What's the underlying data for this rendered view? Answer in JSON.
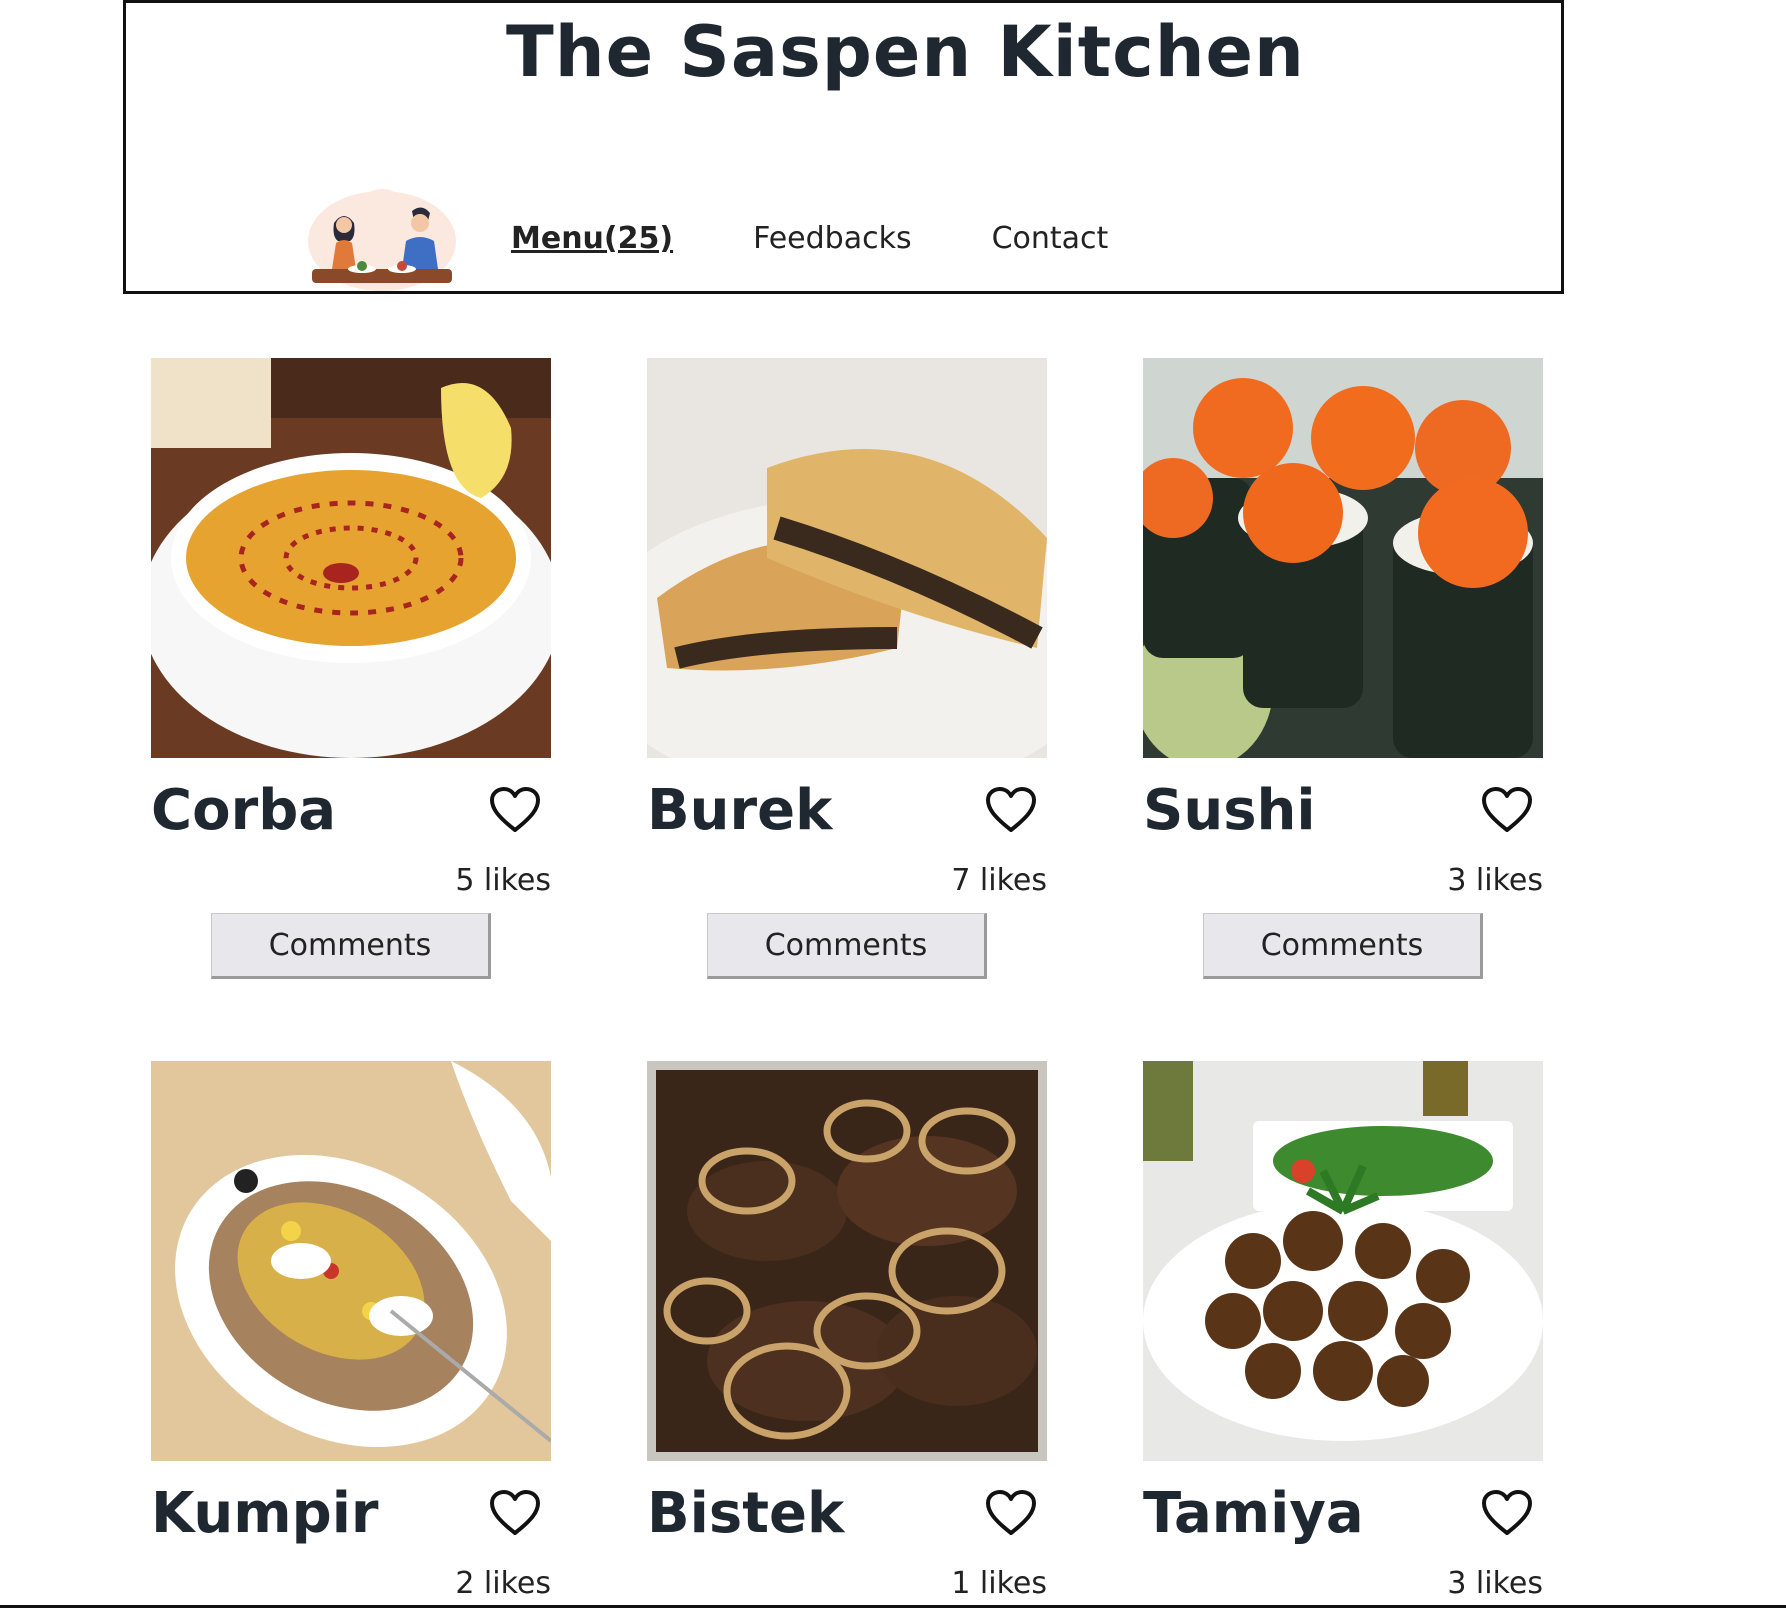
{
  "header": {
    "title": "The Saspen Kitchen",
    "nav": [
      {
        "label": "Menu(25)",
        "active": true
      },
      {
        "label": "Feedbacks",
        "active": false
      },
      {
        "label": "Contact",
        "active": false
      }
    ]
  },
  "menu": {
    "comments_label": "Comments",
    "items": [
      {
        "name": "Corba",
        "likes": "5 likes"
      },
      {
        "name": "Burek",
        "likes": "7 likes"
      },
      {
        "name": "Sushi",
        "likes": "3 likes"
      },
      {
        "name": "Kumpir",
        "likes": "2 likes"
      },
      {
        "name": "Bistek",
        "likes": "1 likes"
      },
      {
        "name": "Tamiya",
        "likes": "3 likes"
      }
    ]
  }
}
